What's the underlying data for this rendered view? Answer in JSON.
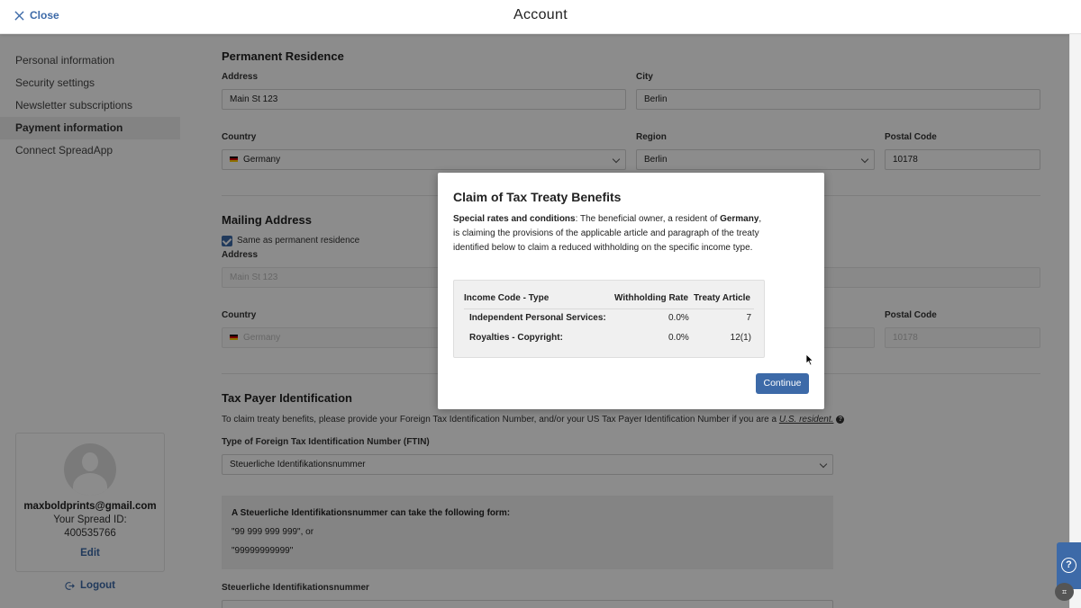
{
  "header": {
    "close_label": "Close",
    "title": "Account"
  },
  "sidebar": {
    "items": [
      {
        "label": "Personal information",
        "active": false
      },
      {
        "label": "Security settings",
        "active": false
      },
      {
        "label": "Newsletter subscriptions",
        "active": false
      },
      {
        "label": "Payment information",
        "active": true
      },
      {
        "label": "Connect SpreadApp",
        "active": false
      }
    ],
    "profile": {
      "email": "maxboldprints@gmail.com",
      "spread_id_label": "Your Spread ID:",
      "spread_id": "400535766",
      "edit_label": "Edit"
    },
    "logout_label": "Logout"
  },
  "main": {
    "permanent": {
      "title": "Permanent Residence",
      "address_label": "Address",
      "address_value": "Main St 123",
      "city_label": "City",
      "city_value": "Berlin",
      "country_label": "Country",
      "country_value": "Germany",
      "region_label": "Region",
      "region_value": "Berlin",
      "postal_label": "Postal Code",
      "postal_value": "10178"
    },
    "mailing": {
      "title": "Mailing Address",
      "same_as_label": "Same as permanent residence",
      "address_label": "Address",
      "address_value": "Main St 123",
      "country_label": "Country",
      "country_value": "Germany",
      "postal_label": "Postal Code",
      "postal_value": "10178"
    },
    "tax": {
      "title": "Tax Payer Identification",
      "description": "To claim treaty benefits, please provide your Foreign Tax Identification Number, and/or your US Tax Payer Identification Number if you are a ",
      "us_resident_link": "U.S. resident.",
      "ftin_type_label": "Type of Foreign Tax Identification Number (FTIN)",
      "ftin_type_value": "Steuerliche Identifikationsnummer",
      "info_title": "A Steuerliche Identifikationsnummer can take the following form:",
      "info_form1": "\"99 999 999 999\", or",
      "info_form2": "\"99999999999\"",
      "ftin_number_label": "Steuerliche Identifikationsnummer"
    }
  },
  "modal": {
    "title": "Claim of Tax Treaty Benefits",
    "intro_bold": "Special rates and conditions",
    "intro_1": ": The beneficial owner, a resident of ",
    "country_bold": "Germany",
    "intro_2": ", is claiming the provisions of the applicable article and paragraph of the treaty identified below to claim a reduced withholding on the specific income type.",
    "table": {
      "headers": [
        "Income Code - Type",
        "Withholding Rate",
        "Treaty Article"
      ],
      "rows": [
        {
          "type": "Independent Personal Services:",
          "rate": "0.0%",
          "article": "7"
        },
        {
          "type": "Royalties - Copyright:",
          "rate": "0.0%",
          "article": "12(1)"
        }
      ]
    },
    "continue_label": "Continue"
  },
  "help": {
    "fab_glyph": "?",
    "corner_icon": "scan-icon"
  }
}
